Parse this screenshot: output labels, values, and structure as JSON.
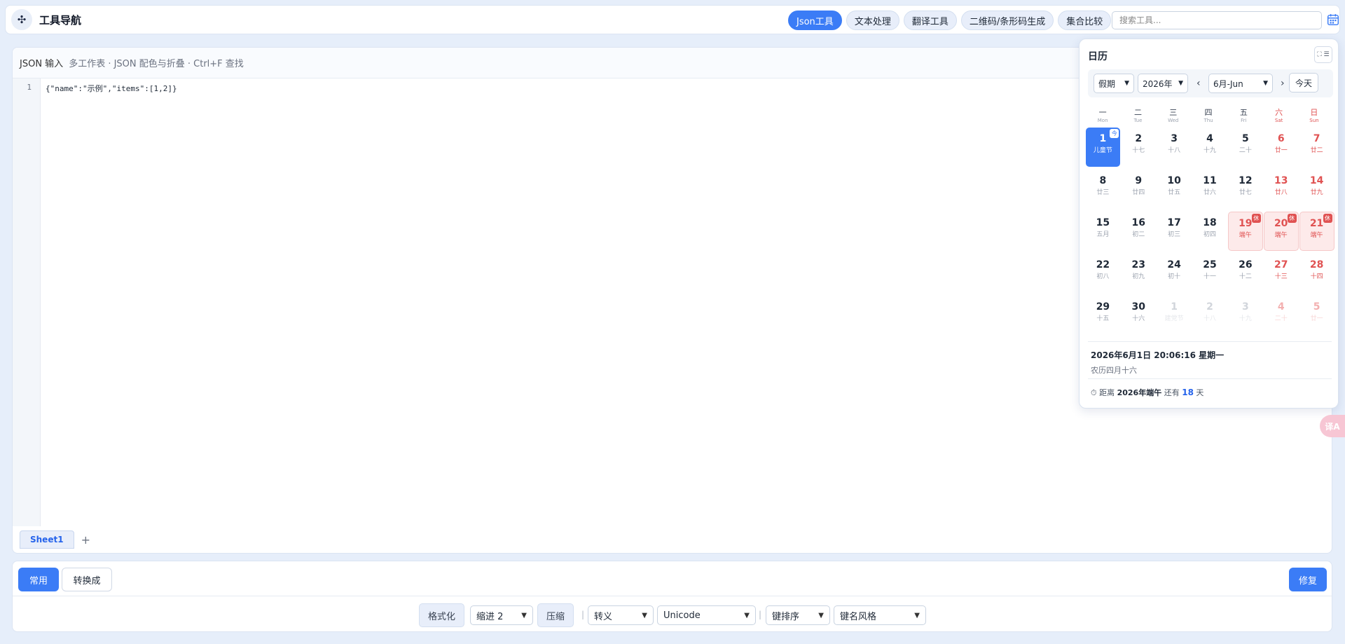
{
  "app": {
    "title": "工具导航"
  },
  "nav": {
    "tabs": [
      {
        "label": "Json工具",
        "active": true
      },
      {
        "label": "文本处理"
      },
      {
        "label": "翻译工具"
      },
      {
        "label": "二维码/条形码生成"
      },
      {
        "label": "集合比较"
      }
    ],
    "search_placeholder": "搜索工具..."
  },
  "editor": {
    "title": "JSON 输入",
    "subtitle": "多工作表 · JSON 配色与折叠 · Ctrl+F 查找",
    "line_numbers": [
      "1"
    ],
    "content": "{\"name\":\"示例\",\"items\":[1,2]}",
    "sheets": [
      {
        "label": "Sheet1"
      }
    ],
    "add_sheet": "+"
  },
  "toolbar": {
    "tab_common": "常用",
    "tab_convert": "转换成",
    "repair": "修复",
    "format": "格式化",
    "indent": "缩进 2",
    "compress": "压缩",
    "escape": "转义",
    "encoding": "Unicode",
    "key_sort": "键排序",
    "key_style": "键名风格",
    "separator": "|"
  },
  "calendar": {
    "title": "日历",
    "mode": "假期",
    "year": "2026年",
    "month": "6月-Jun",
    "prev": "‹",
    "next": "›",
    "today_label": "今天",
    "weekdays": [
      {
        "cn": "一",
        "en": "Mon"
      },
      {
        "cn": "二",
        "en": "Tue"
      },
      {
        "cn": "三",
        "en": "Wed"
      },
      {
        "cn": "四",
        "en": "Thu"
      },
      {
        "cn": "五",
        "en": "Fri"
      },
      {
        "cn": "六",
        "en": "Sat"
      },
      {
        "cn": "日",
        "en": "Sun"
      }
    ],
    "weeks": [
      [
        {
          "d": "1",
          "l": "儿童节",
          "today": true,
          "badge": "今"
        },
        {
          "d": "2",
          "l": "十七"
        },
        {
          "d": "3",
          "l": "十八"
        },
        {
          "d": "4",
          "l": "十九"
        },
        {
          "d": "5",
          "l": "二十"
        },
        {
          "d": "6",
          "l": "廿一"
        },
        {
          "d": "7",
          "l": "廿二"
        }
      ],
      [
        {
          "d": "8",
          "l": "廿三"
        },
        {
          "d": "9",
          "l": "廿四"
        },
        {
          "d": "10",
          "l": "廿五"
        },
        {
          "d": "11",
          "l": "廿六"
        },
        {
          "d": "12",
          "l": "廿七"
        },
        {
          "d": "13",
          "l": "廿八"
        },
        {
          "d": "14",
          "l": "廿九"
        }
      ],
      [
        {
          "d": "15",
          "l": "五月"
        },
        {
          "d": "16",
          "l": "初二"
        },
        {
          "d": "17",
          "l": "初三"
        },
        {
          "d": "18",
          "l": "初四"
        },
        {
          "d": "19",
          "l": "端午",
          "holiday": true,
          "badge": "休"
        },
        {
          "d": "20",
          "l": "端午",
          "holiday": true,
          "badge": "休"
        },
        {
          "d": "21",
          "l": "端午",
          "holiday": true,
          "badge": "休"
        }
      ],
      [
        {
          "d": "22",
          "l": "初八"
        },
        {
          "d": "23",
          "l": "初九"
        },
        {
          "d": "24",
          "l": "初十"
        },
        {
          "d": "25",
          "l": "十一"
        },
        {
          "d": "26",
          "l": "十二"
        },
        {
          "d": "27",
          "l": "十三"
        },
        {
          "d": "28",
          "l": "十四"
        }
      ],
      [
        {
          "d": "29",
          "l": "十五"
        },
        {
          "d": "30",
          "l": "十六"
        },
        {
          "d": "1",
          "l": "建党节",
          "other": true
        },
        {
          "d": "2",
          "l": "十八",
          "other": true
        },
        {
          "d": "3",
          "l": "十九",
          "other": true
        },
        {
          "d": "4",
          "l": "二十",
          "other": true
        },
        {
          "d": "5",
          "l": "廿一",
          "other": true
        }
      ]
    ],
    "datetime": "2026年6月1日 20:06:16 星期一",
    "lunar": "农历四月十六",
    "countdown": {
      "prefix": "距离",
      "event": "2026年端午",
      "mid": "还有",
      "days": "18",
      "suffix": "天"
    }
  },
  "colors": {
    "accent": "#3b7cf6",
    "holiday": "#e05252"
  }
}
